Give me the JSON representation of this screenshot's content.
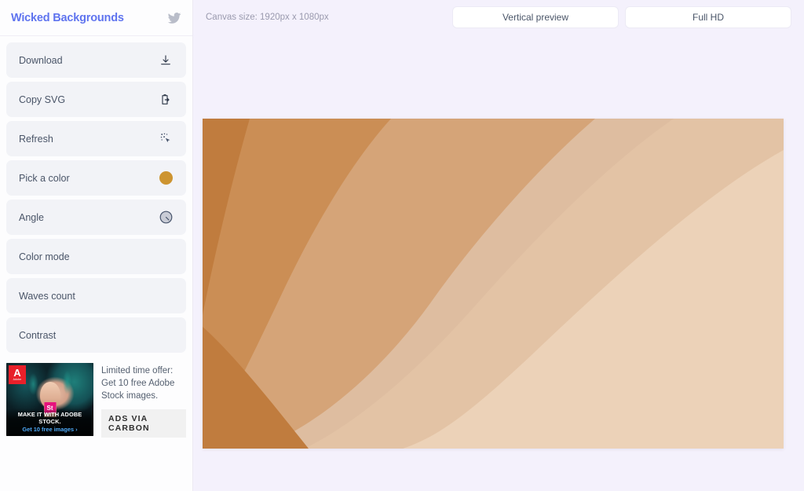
{
  "sidebar": {
    "brand": {
      "title": "Wicked Backgrounds",
      "social_icon": "twitter-icon"
    },
    "controls": [
      {
        "label": "Download",
        "icon": "download-icon"
      },
      {
        "label": "Copy SVG",
        "icon": "clipboard-copy-icon"
      },
      {
        "label": "Refresh",
        "icon": "magic-cursor-icon"
      },
      {
        "label": "Pick a color",
        "icon": "color-swatch",
        "swatch_color": "#cd9430"
      },
      {
        "label": "Angle",
        "icon": "dial-knob-icon"
      },
      {
        "label": "Color mode",
        "icon": ""
      },
      {
        "label": "Waves count",
        "icon": ""
      },
      {
        "label": "Contrast",
        "icon": ""
      }
    ],
    "ad": {
      "image_logo_letter": "A",
      "image_logo_word": "Adobe",
      "image_badge": "St",
      "image_caption": "MAKE IT WITH ADOBE STOCK.",
      "image_subcaption": "Get 10 free images ›",
      "text": "Limited time offer: Get 10 free Adobe Stock images.",
      "via_label": "ADS VIA CARBON"
    }
  },
  "main": {
    "canvas_size_label": "Canvas size: 1920px x 1080px",
    "buttons": [
      {
        "label": "Vertical preview"
      },
      {
        "label": "Full HD"
      }
    ],
    "preview": {
      "colors": {
        "band1": "#c07c3e",
        "band2": "#cb8e55",
        "band3": "#d5a478",
        "band4": "#debda0",
        "band5": "#e3c3a5",
        "band6": "#ecd2b8"
      }
    }
  },
  "theme": {
    "brand_color": "#5f74ef",
    "sidebar_bg": "#fdfdfe",
    "control_bg": "#f2f3f7",
    "main_bg": "#f4f1fc",
    "text_color": "#4a5568"
  }
}
